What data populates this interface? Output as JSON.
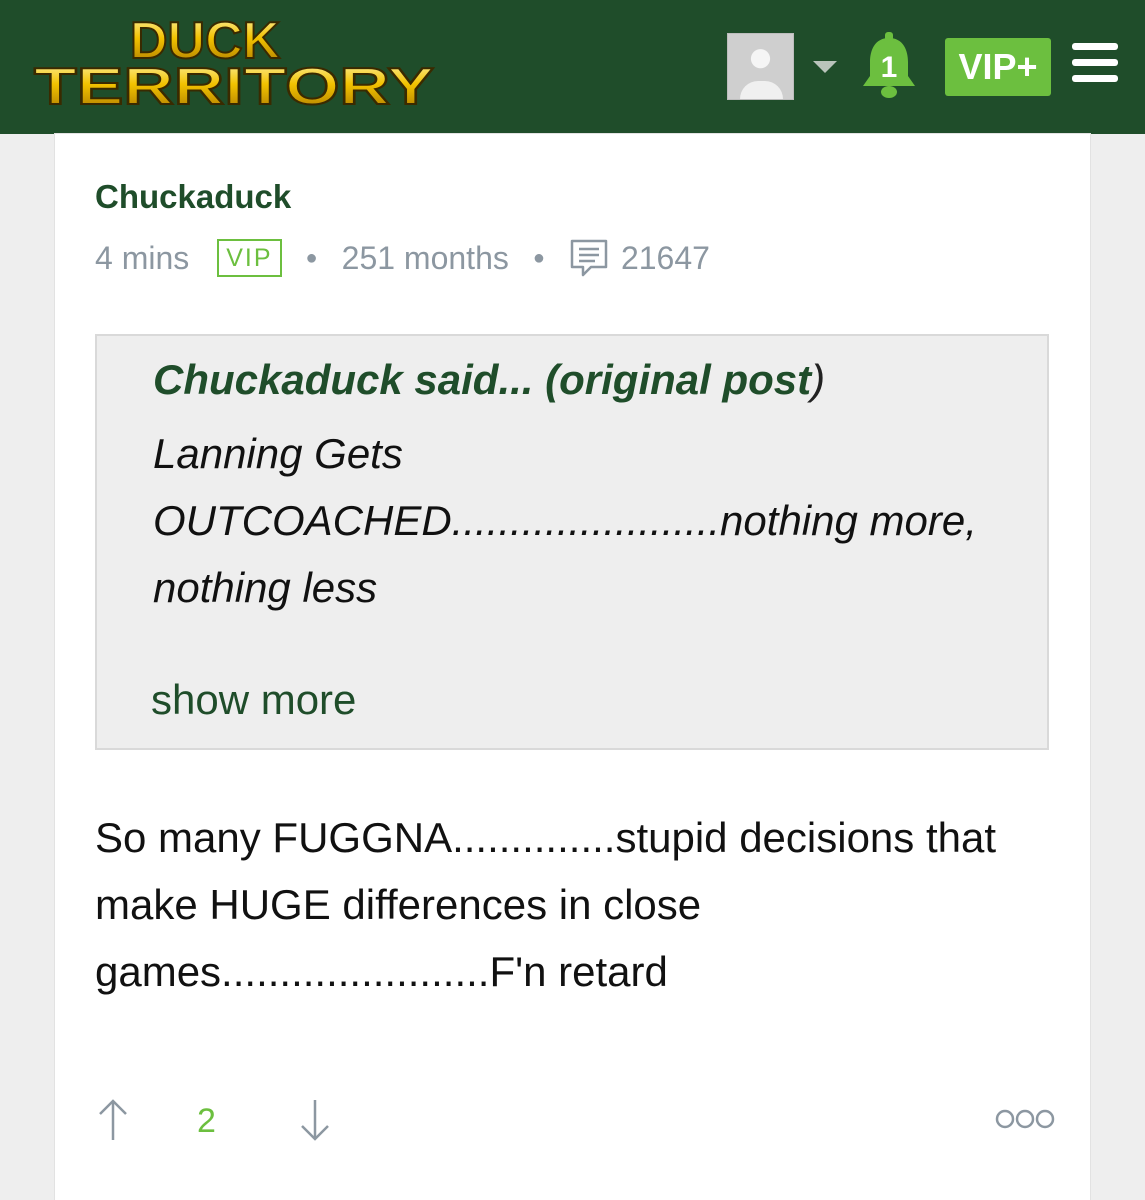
{
  "header": {
    "logo_line1": "DUCK",
    "logo_line2": "TERRITORY",
    "notification_count": "1",
    "vip_plus_label": "VIP+",
    "colors": {
      "bar": "#1f4d2a",
      "accent": "#6cbf3f",
      "logo_gold": "#f2c200"
    }
  },
  "post": {
    "author": "Chuckaduck",
    "time_ago": "4 mins",
    "badge": "VIP",
    "membership": "251 months",
    "post_count": "21647",
    "quote": {
      "header": "Chuckaduck said... (original post",
      "header_close": ")",
      "body": "Lanning Gets OUTCOACHED.......................nothing more, nothing less",
      "show_more_label": "show more"
    },
    "body": "So many FUGGNA..............stupid decisions that make HUGE differences in close games.......................F'n retard",
    "score": "2"
  },
  "icons": [
    "avatar",
    "caret-down-icon",
    "bell-icon",
    "hamburger-menu-icon",
    "comment-icon",
    "arrow-up-icon",
    "arrow-down-icon",
    "more-options-icon"
  ]
}
